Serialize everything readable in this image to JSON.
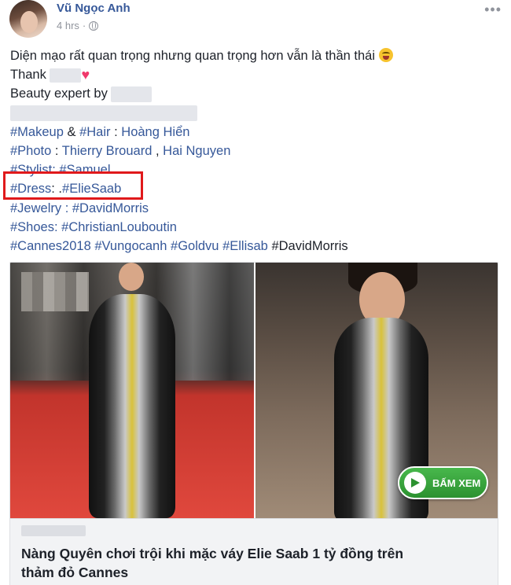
{
  "post": {
    "author": "Vũ Ngọc Anh",
    "timestamp": "4 hrs",
    "separator": "·",
    "more_label": "•••",
    "lines": {
      "l1": "Diện mạo rất quan trọng nhưng quan trọng hơn vẫn là thần thái",
      "l2": "Thank",
      "l3": "Beauty expert by",
      "l5": {
        "tag1": "#Makeup",
        "mid": " & ",
        "tag2": "#Hair",
        "sep": " : ",
        "name": "Hoàng Hiển"
      },
      "l6": {
        "tag": "#Photo",
        "sep": " : ",
        "n1": "Thierry Brouard",
        "comma": " , ",
        "n2": "Hai Nguyen"
      },
      "l7": {
        "tag": "#Stylist",
        "sep": ": ",
        "tag2": "#Samuel"
      },
      "l8": {
        "tag": "#Dress",
        "sep": ": .",
        "tag2": "#ElieSaab"
      },
      "l9": {
        "tag": "#Jewelry",
        "sep": " : ",
        "tag2": "#DavidMorris"
      },
      "l10": {
        "tag": "#Shoes",
        "sep": ": ",
        "tag2": "#ChristianLouboutin"
      },
      "l11": {
        "t1": "#Cannes2018",
        "t2": "#Vungocanh",
        "t3": "#Goldvu",
        "t4": "#Ellisab",
        "t5": "#DavidMorris"
      }
    }
  },
  "card": {
    "cta_label": "BẤM XEM",
    "title_line1": "Nàng Quyên chơi trội khi mặc váy Elie Saab 1 tỷ đồng trên",
    "title_line2": "thảm đỏ Cannes"
  },
  "colors": {
    "link": "#365899",
    "text": "#1d2129",
    "highlight": "#e0191b",
    "cta": "#2c9230"
  },
  "icons": [
    "globe-icon",
    "heart-icon",
    "squint-tongue-emoji",
    "play-icon",
    "more-icon"
  ]
}
